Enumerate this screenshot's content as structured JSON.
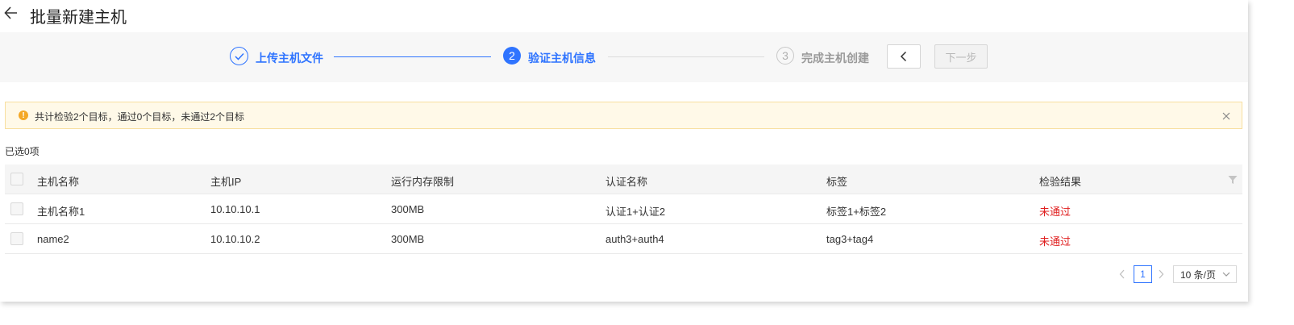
{
  "header": {
    "title": "批量新建主机",
    "back_icon": "arrow-left-icon"
  },
  "steps": [
    {
      "number": "1",
      "label": "上传主机文件",
      "status": "done",
      "icon": "check-circle-icon"
    },
    {
      "number": "2",
      "label": "验证主机信息",
      "status": "current"
    },
    {
      "number": "3",
      "label": "完成主机创建",
      "status": "pending"
    }
  ],
  "step_nav": {
    "prev_icon": "chevron-left-icon",
    "next_label": "下一步"
  },
  "alert": {
    "text": "共计检验2个目标，通过0个目标，未通过2个目标",
    "icon": "warning-circle-icon",
    "close_icon": "close-icon"
  },
  "selection": {
    "text": "已选0项"
  },
  "table": {
    "columns": [
      "主机名称",
      "主机IP",
      "运行内存限制",
      "认证名称",
      "标签",
      "检验结果"
    ],
    "rows": [
      [
        "主机名称1",
        "10.10.10.1",
        "300MB",
        "认证1+认证2",
        "标签1+标签2",
        "未通过"
      ],
      [
        "name2",
        "10.10.10.2",
        "300MB",
        "auth3+auth4",
        "tag3+tag4",
        "未通过"
      ]
    ],
    "filter_icon": "filter-icon"
  },
  "pagination": {
    "current_page": "1",
    "page_size": "10 条/页"
  },
  "colors": {
    "primary": "#2f74ff",
    "fail": "#e02020",
    "warning": "#f4a826",
    "alert_bg": "#fff9e8"
  }
}
